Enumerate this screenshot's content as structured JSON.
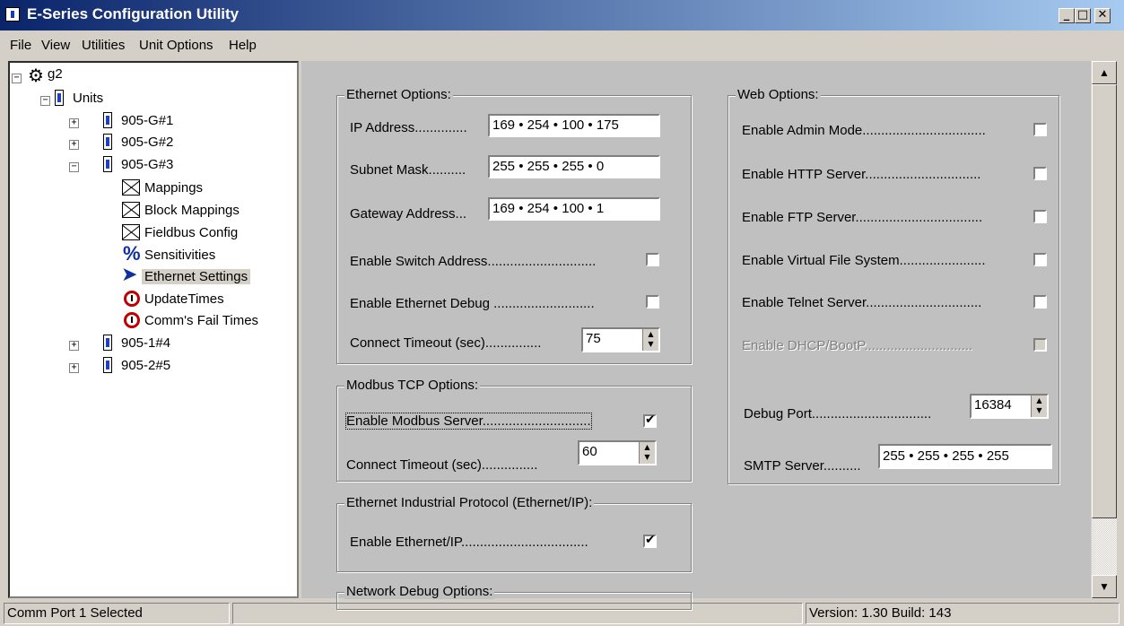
{
  "window": {
    "title": "E-Series Configuration Utility",
    "min": "_",
    "max": "□",
    "close": "✕"
  },
  "menu": [
    "File",
    "View",
    "Utilities",
    "Unit Options",
    "Help"
  ],
  "tree": {
    "root": "g2",
    "units": "Units",
    "unit1": "905-G#1",
    "unit2": "905-G#2",
    "unit3": "905-G#3",
    "children": [
      "Mappings",
      "Block Mappings",
      "Fieldbus Config",
      "Sensitivities",
      "Ethernet Settings",
      "UpdateTimes",
      "Comm's Fail Times"
    ],
    "unit4": "905-1#4",
    "unit5": "905-2#5",
    "selected": "Ethernet Settings"
  },
  "ethernet": {
    "legend": "Ethernet Options:",
    "ip_label": "IP Address..............",
    "ip_value": "169 • 254 • 100 • 175",
    "subnet_label": "Subnet Mask..........",
    "subnet_value": "255 • 255 • 255 • 0",
    "gateway_label": "Gateway Address...",
    "gateway_value": "169 • 254 • 100 • 1",
    "switch_label": "Enable Switch Address.............................",
    "switch_checked": false,
    "debug_label": "Enable Ethernet Debug ...........................",
    "debug_checked": false,
    "timeout_label": "Connect Timeout (sec)...............",
    "timeout_value": "75"
  },
  "modbus": {
    "legend": "Modbus TCP Options:",
    "server_label": "Enable Modbus Server.............................",
    "server_checked": true,
    "timeout_label": "Connect Timeout (sec)...............",
    "timeout_value": "60"
  },
  "enip": {
    "legend": "Ethernet Industrial Protocol (Ethernet/IP):",
    "enable_label": "Enable Ethernet/IP..................................",
    "enable_checked": true
  },
  "netdebug": {
    "legend": "Network Debug Options:"
  },
  "web": {
    "legend": "Web Options:",
    "admin_label": "Enable Admin Mode.................................",
    "http_label": "Enable HTTP Server...............................",
    "ftp_label": "Enable FTP Server..................................",
    "vfs_label": "Enable Virtual File System.......................",
    "telnet_label": "Enable Telnet Server...............................",
    "dhcp_label": "Enable DHCP/BootP.............................",
    "debug_port_label": "Debug Port................................",
    "debug_port_value": "16384",
    "smtp_label": "SMTP Server..........",
    "smtp_value": "255 • 255 • 255 • 255"
  },
  "status": {
    "left": "Comm Port 1 Selected",
    "middle": "",
    "right": "Version: 1.30 Build: 143"
  }
}
